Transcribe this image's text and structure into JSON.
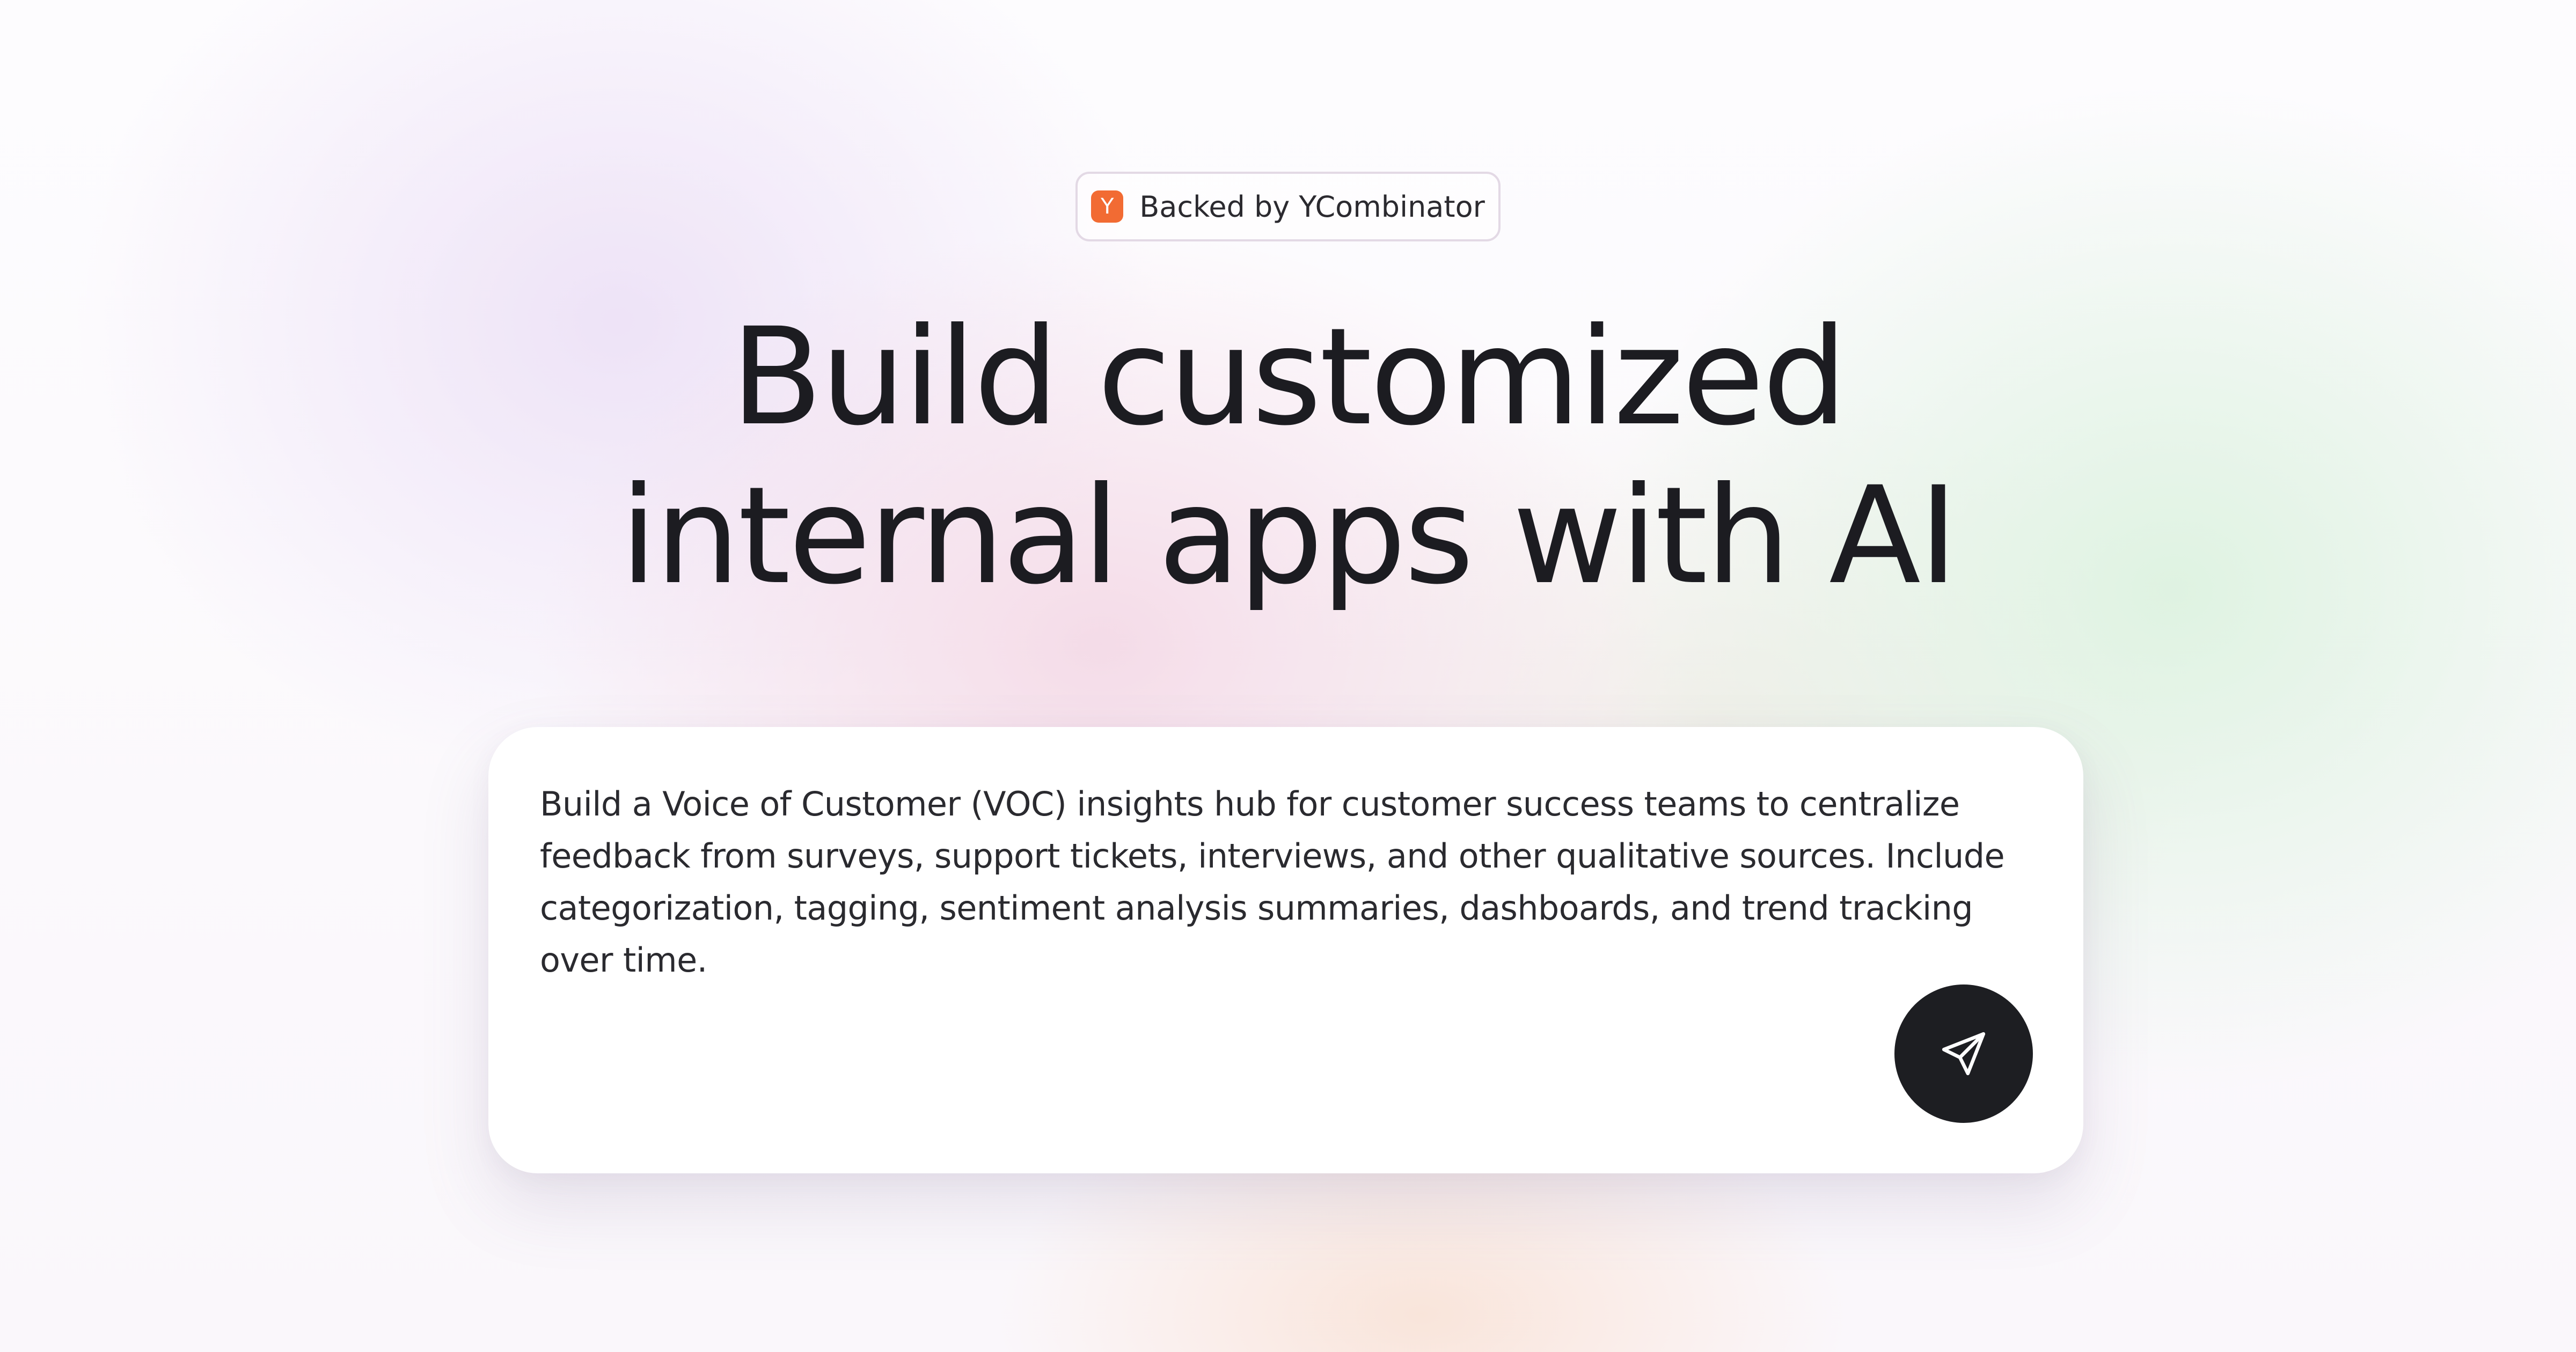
{
  "badge": {
    "logo_letter": "Y",
    "text": "Backed by YCombinator",
    "logo_color": "#f26b33"
  },
  "headline": {
    "line1": "Build customized",
    "line2": "internal apps with AI"
  },
  "prompt": {
    "text": "Build a Voice of Customer (VOC) insights hub for customer success teams to centralize feedback from surveys, support tickets, interviews, and other qualitative sources. Include categorization, tagging, sentiment analysis summaries, dashboards, and trend tracking over time.",
    "send_icon": "send-icon"
  },
  "colors": {
    "text": "#1c1c21",
    "send_button": "#1d1e22",
    "card": "#ffffff"
  }
}
